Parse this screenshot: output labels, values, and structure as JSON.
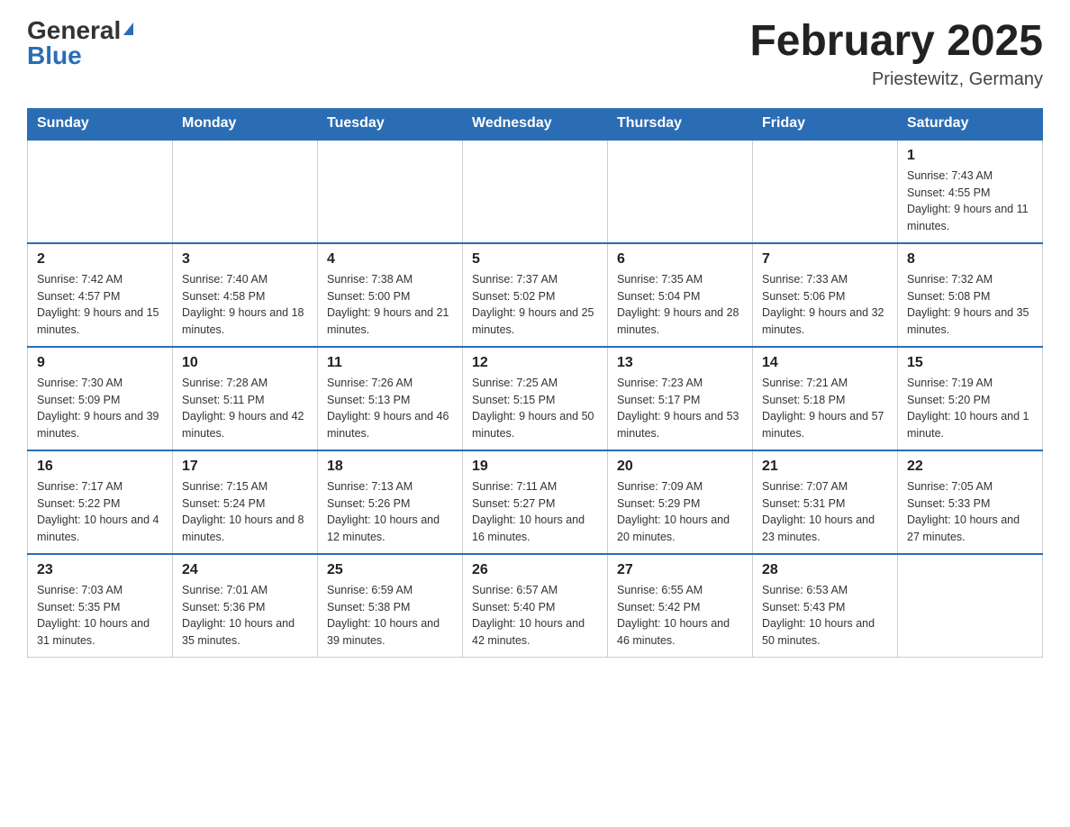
{
  "header": {
    "logo": {
      "general": "General",
      "triangle": "▲",
      "blue": "Blue"
    },
    "title": "February 2025",
    "location": "Priestewitz, Germany"
  },
  "days_of_week": [
    "Sunday",
    "Monday",
    "Tuesday",
    "Wednesday",
    "Thursday",
    "Friday",
    "Saturday"
  ],
  "weeks": [
    [
      {
        "day": "",
        "info": ""
      },
      {
        "day": "",
        "info": ""
      },
      {
        "day": "",
        "info": ""
      },
      {
        "day": "",
        "info": ""
      },
      {
        "day": "",
        "info": ""
      },
      {
        "day": "",
        "info": ""
      },
      {
        "day": "1",
        "info": "Sunrise: 7:43 AM\nSunset: 4:55 PM\nDaylight: 9 hours and 11 minutes."
      }
    ],
    [
      {
        "day": "2",
        "info": "Sunrise: 7:42 AM\nSunset: 4:57 PM\nDaylight: 9 hours and 15 minutes."
      },
      {
        "day": "3",
        "info": "Sunrise: 7:40 AM\nSunset: 4:58 PM\nDaylight: 9 hours and 18 minutes."
      },
      {
        "day": "4",
        "info": "Sunrise: 7:38 AM\nSunset: 5:00 PM\nDaylight: 9 hours and 21 minutes."
      },
      {
        "day": "5",
        "info": "Sunrise: 7:37 AM\nSunset: 5:02 PM\nDaylight: 9 hours and 25 minutes."
      },
      {
        "day": "6",
        "info": "Sunrise: 7:35 AM\nSunset: 5:04 PM\nDaylight: 9 hours and 28 minutes."
      },
      {
        "day": "7",
        "info": "Sunrise: 7:33 AM\nSunset: 5:06 PM\nDaylight: 9 hours and 32 minutes."
      },
      {
        "day": "8",
        "info": "Sunrise: 7:32 AM\nSunset: 5:08 PM\nDaylight: 9 hours and 35 minutes."
      }
    ],
    [
      {
        "day": "9",
        "info": "Sunrise: 7:30 AM\nSunset: 5:09 PM\nDaylight: 9 hours and 39 minutes."
      },
      {
        "day": "10",
        "info": "Sunrise: 7:28 AM\nSunset: 5:11 PM\nDaylight: 9 hours and 42 minutes."
      },
      {
        "day": "11",
        "info": "Sunrise: 7:26 AM\nSunset: 5:13 PM\nDaylight: 9 hours and 46 minutes."
      },
      {
        "day": "12",
        "info": "Sunrise: 7:25 AM\nSunset: 5:15 PM\nDaylight: 9 hours and 50 minutes."
      },
      {
        "day": "13",
        "info": "Sunrise: 7:23 AM\nSunset: 5:17 PM\nDaylight: 9 hours and 53 minutes."
      },
      {
        "day": "14",
        "info": "Sunrise: 7:21 AM\nSunset: 5:18 PM\nDaylight: 9 hours and 57 minutes."
      },
      {
        "day": "15",
        "info": "Sunrise: 7:19 AM\nSunset: 5:20 PM\nDaylight: 10 hours and 1 minute."
      }
    ],
    [
      {
        "day": "16",
        "info": "Sunrise: 7:17 AM\nSunset: 5:22 PM\nDaylight: 10 hours and 4 minutes."
      },
      {
        "day": "17",
        "info": "Sunrise: 7:15 AM\nSunset: 5:24 PM\nDaylight: 10 hours and 8 minutes."
      },
      {
        "day": "18",
        "info": "Sunrise: 7:13 AM\nSunset: 5:26 PM\nDaylight: 10 hours and 12 minutes."
      },
      {
        "day": "19",
        "info": "Sunrise: 7:11 AM\nSunset: 5:27 PM\nDaylight: 10 hours and 16 minutes."
      },
      {
        "day": "20",
        "info": "Sunrise: 7:09 AM\nSunset: 5:29 PM\nDaylight: 10 hours and 20 minutes."
      },
      {
        "day": "21",
        "info": "Sunrise: 7:07 AM\nSunset: 5:31 PM\nDaylight: 10 hours and 23 minutes."
      },
      {
        "day": "22",
        "info": "Sunrise: 7:05 AM\nSunset: 5:33 PM\nDaylight: 10 hours and 27 minutes."
      }
    ],
    [
      {
        "day": "23",
        "info": "Sunrise: 7:03 AM\nSunset: 5:35 PM\nDaylight: 10 hours and 31 minutes."
      },
      {
        "day": "24",
        "info": "Sunrise: 7:01 AM\nSunset: 5:36 PM\nDaylight: 10 hours and 35 minutes."
      },
      {
        "day": "25",
        "info": "Sunrise: 6:59 AM\nSunset: 5:38 PM\nDaylight: 10 hours and 39 minutes."
      },
      {
        "day": "26",
        "info": "Sunrise: 6:57 AM\nSunset: 5:40 PM\nDaylight: 10 hours and 42 minutes."
      },
      {
        "day": "27",
        "info": "Sunrise: 6:55 AM\nSunset: 5:42 PM\nDaylight: 10 hours and 46 minutes."
      },
      {
        "day": "28",
        "info": "Sunrise: 6:53 AM\nSunset: 5:43 PM\nDaylight: 10 hours and 50 minutes."
      },
      {
        "day": "",
        "info": ""
      }
    ]
  ]
}
